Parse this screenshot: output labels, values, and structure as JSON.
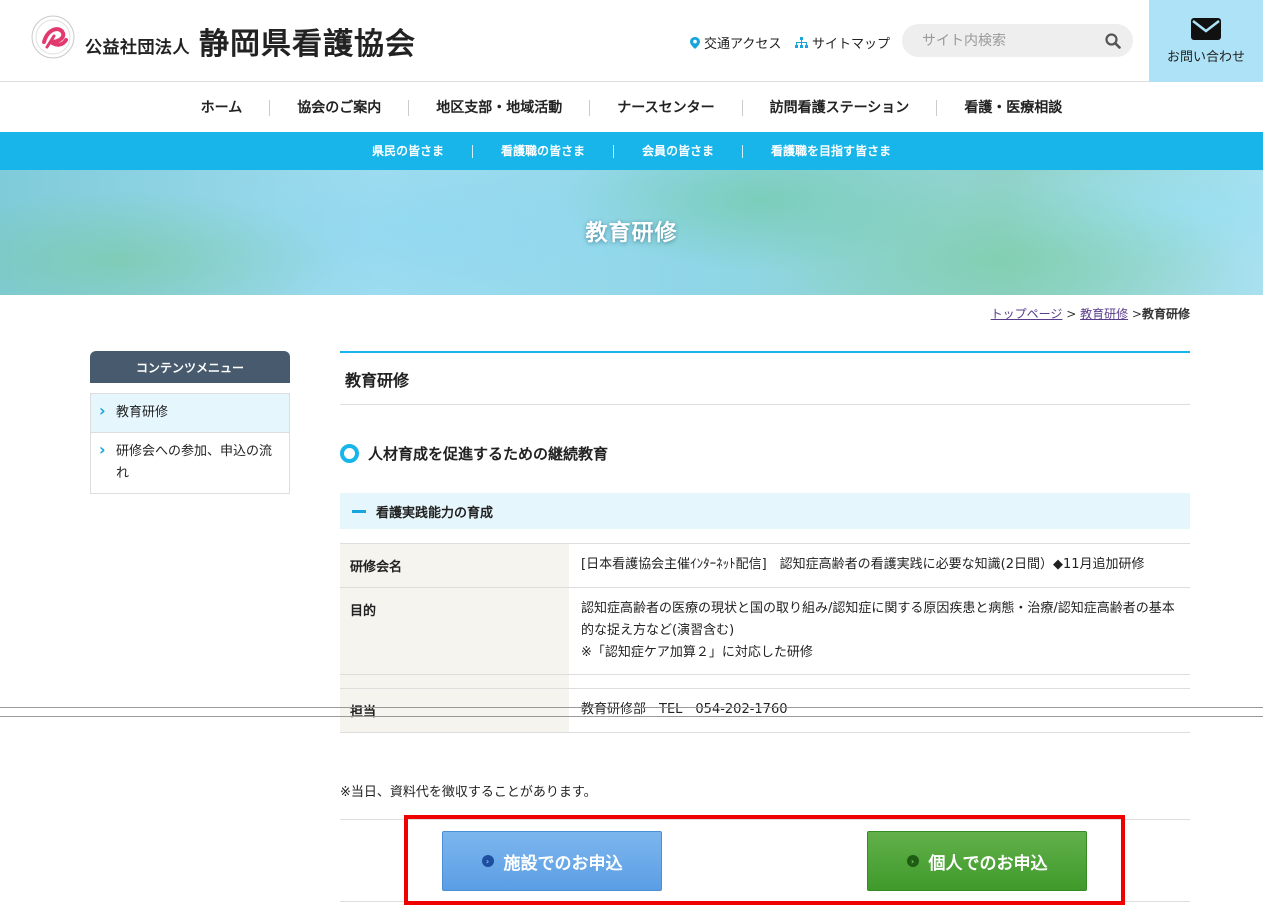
{
  "header": {
    "org_prefix": "公益社団法人",
    "org_name": "静岡県看護協会",
    "access_label": "交通アクセス",
    "sitemap_label": "サイトマップ",
    "search_placeholder": "サイト内検索",
    "contact_label": "お問い合わせ"
  },
  "main_nav": [
    "ホーム",
    "協会のご案内",
    "地区支部・地域活動",
    "ナースセンター",
    "訪問看護ステーション",
    "看護・医療相談"
  ],
  "sub_nav": [
    "県民の皆さま",
    "看護職の皆さま",
    "会員の皆さま",
    "看護職を目指す皆さま"
  ],
  "hero": {
    "title": "教育研修"
  },
  "breadcrumb": {
    "top": "トップページ",
    "sep1": " > ",
    "mid": "教育研修",
    "sep2": " >",
    "current": "教育研修"
  },
  "sidebar": {
    "heading": "コンテンツメニュー",
    "items": [
      "教育研修",
      "研修会への参加、申込の流れ"
    ]
  },
  "content": {
    "page_title": "教育研修",
    "section_title": "人材育成を促進するための継続教育",
    "subsection_title": "看護実践能力の育成",
    "rows": [
      {
        "label": "研修会名",
        "value": "[日本看護協会主催ｲﾝﾀｰﾈｯﾄ配信]　認知症高齢者の看護実践に必要な知識(2日間）◆11月追加研修"
      },
      {
        "label": "目的",
        "value": "認知症高齢者の医療の現状と国の取り組み/認知症に関する原因疾患と病態・治療/認知症高齢者の基本的な捉え方など(演習含む)",
        "value2": "※「認知症ケア加算２」に対応した研修"
      },
      {
        "label": "担当",
        "value": "教育研修部　TEL　054-202-1760"
      }
    ],
    "note": "※当日、資料代を徴収することがあります。",
    "buttons": {
      "facility": "施設でのお申込",
      "personal": "個人でのお申込"
    }
  },
  "colors": {
    "accent": "#17b5e9",
    "sidebar_head": "#475a6e",
    "highlight": "#ee0000",
    "contact_bg": "#aee3f7"
  },
  "icons": [
    "logo-emblem",
    "map-pin-icon",
    "sitemap-icon",
    "search-icon",
    "mail-icon",
    "chevron-right-icon"
  ]
}
